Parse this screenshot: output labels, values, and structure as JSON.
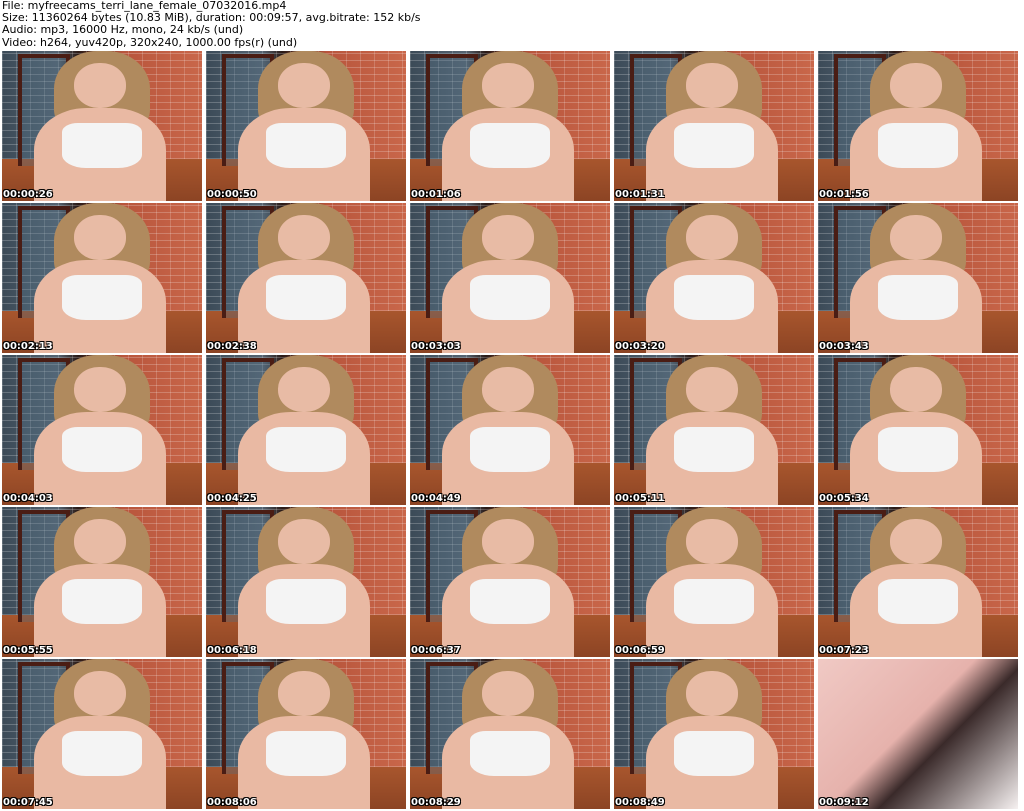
{
  "header": {
    "file": "File: myfreecams_terri_lane_female_07032016.mp4",
    "size": "Size: 11360264 bytes (10.83 MiB), duration: 00:09:57, avg.bitrate: 152 kb/s",
    "audio": "Audio: mp3, 16000 Hz, mono, 24 kb/s (und)",
    "video": "Video: h264, yuv420p, 320x240, 1000.00 fps(r) (und)"
  },
  "thumbnails": [
    {
      "timestamp": "00:00:26"
    },
    {
      "timestamp": "00:00:50"
    },
    {
      "timestamp": "00:01:06"
    },
    {
      "timestamp": "00:01:31"
    },
    {
      "timestamp": "00:01:56"
    },
    {
      "timestamp": "00:02:13"
    },
    {
      "timestamp": "00:02:38"
    },
    {
      "timestamp": "00:03:03"
    },
    {
      "timestamp": "00:03:20"
    },
    {
      "timestamp": "00:03:43"
    },
    {
      "timestamp": "00:04:03"
    },
    {
      "timestamp": "00:04:25"
    },
    {
      "timestamp": "00:04:49"
    },
    {
      "timestamp": "00:05:11"
    },
    {
      "timestamp": "00:05:34"
    },
    {
      "timestamp": "00:05:55"
    },
    {
      "timestamp": "00:06:18"
    },
    {
      "timestamp": "00:06:37"
    },
    {
      "timestamp": "00:06:59"
    },
    {
      "timestamp": "00:07:23"
    },
    {
      "timestamp": "00:07:45"
    },
    {
      "timestamp": "00:08:06"
    },
    {
      "timestamp": "00:08:29"
    },
    {
      "timestamp": "00:08:49"
    },
    {
      "timestamp": "00:09:12"
    }
  ]
}
